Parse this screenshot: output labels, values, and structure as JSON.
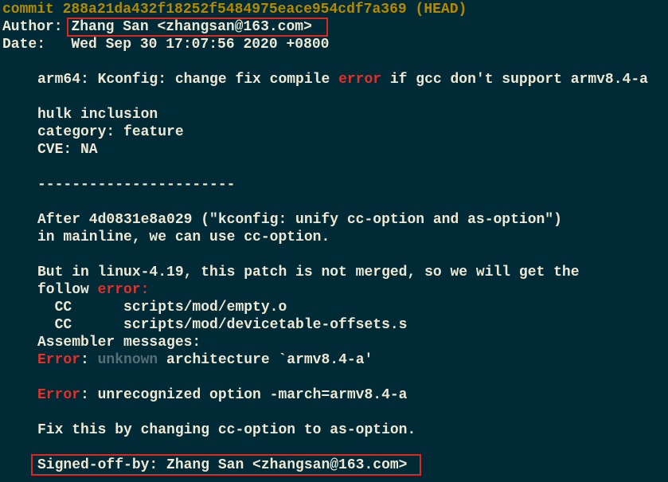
{
  "terminal": {
    "commit": {
      "prefix": "commit",
      "hash": "288a21da432f18252f5484975eace954cdf7a369",
      "ref": "(HEAD)"
    },
    "author": {
      "label": "Author:",
      "value": "Zhang San <zhangsan@163.com>"
    },
    "date": {
      "label": "Date:",
      "value": "Wed Sep 30 17:07:56 2020 +0800"
    },
    "subject": {
      "before": "arm64: Kconfig: change fix compile ",
      "err": "error",
      "after": " if gcc don't support armv8.4-a"
    },
    "meta": {
      "hulk": "hulk inclusion",
      "category": "category: feature",
      "cve": "CVE: NA"
    },
    "separator": "-----------------------",
    "body1": {
      "line1": "After 4d0831e8a029 (\"kconfig: unify cc-option and as-option\")",
      "line2": "in mainline, we can use cc-option."
    },
    "body2": {
      "line1": "But in linux-4.19, this patch is not merged, so we will get the",
      "follow": "follow ",
      "follow_err": "error",
      "follow_colon": ":",
      "cc1": "  CC      scripts/mod/empty.o",
      "cc2": "  CC      scripts/mod/devicetable-offsets.s",
      "asm": "Assembler messages:",
      "e1_label": "Error",
      "e1_colon": ": ",
      "e1_unknown": "unknown",
      "e1_rest": " architecture `armv8.4-a'"
    },
    "body3": {
      "e2_label": "Error",
      "e2_rest": ": unrecognized option -march=armv8.4-a"
    },
    "fix": "Fix this by changing cc-option to as-option.",
    "signed_off": "Signed-off-by: Zhang San <zhangsan@163.com>"
  },
  "colors": {
    "background": "#002b36",
    "text": "#eee8d5",
    "commit_yellow": "#b58900",
    "error_red": "#dc322f",
    "muted_grey": "#586e75",
    "highlight_box": "#e0271f"
  }
}
